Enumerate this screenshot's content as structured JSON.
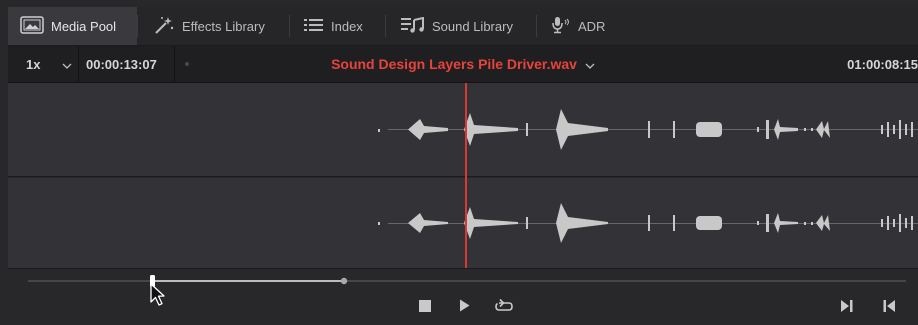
{
  "toolbar": {
    "media_pool": "Media Pool",
    "effects_library": "Effects Library",
    "index": "Index",
    "sound_library": "Sound Library",
    "adr": "ADR"
  },
  "viewer": {
    "speed": "1x",
    "timecode_left": "00:00:13:07",
    "clip_title": "Sound Design Layers Pile Driver.wav",
    "timecode_right": "01:00:08:15",
    "accent_color": "#e8433a",
    "playhead_color": "#d63a33"
  },
  "transport": {
    "buttons": [
      "stop-icon",
      "play-icon",
      "loop-icon",
      "jump-to-end-icon",
      "jump-to-start-icon"
    ]
  }
}
